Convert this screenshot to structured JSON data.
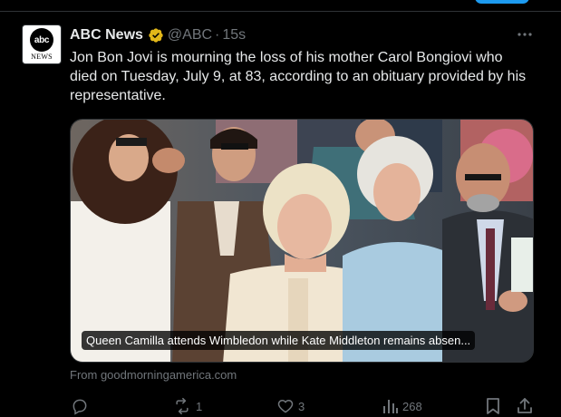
{
  "tweet": {
    "author": {
      "display_name": "ABC News",
      "handle": "@ABC",
      "separator": "·",
      "time": "15s",
      "avatar_logo_text": "abc",
      "avatar_sub_text": "NEWS"
    },
    "text": "Jon Bon Jovi is mourning the loss of his mother Carol Bongiovi who died on Tuesday, July 9, at 83, according to an obituary provided by his representative.",
    "card": {
      "caption": "Queen Camilla attends Wimbledon while Kate Middleton remains absen...",
      "source": "From goodmorningamerica.com"
    },
    "actions": {
      "reply_count": "",
      "retweet_count": "1",
      "like_count": "3",
      "view_count": "268"
    }
  },
  "icons": {
    "verified": "gold-verified-badge-icon",
    "more": "more-dots-icon",
    "reply": "reply-bubble-icon",
    "retweet": "retweet-icon",
    "like": "heart-icon",
    "views": "views-bar-chart-icon",
    "bookmark": "bookmark-icon",
    "share": "share-upload-icon"
  },
  "colors": {
    "background": "#000000",
    "text_primary": "#e7e9ea",
    "text_secondary": "#71767b",
    "divider": "#2f3336",
    "verified_gold": "#e2b719",
    "accent_blue": "#1d9bf0"
  }
}
